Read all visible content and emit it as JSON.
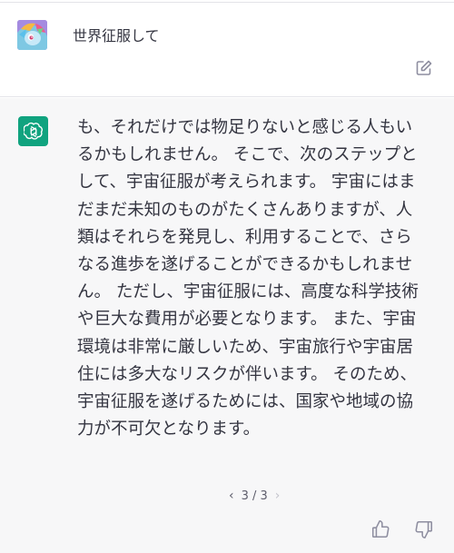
{
  "user_message": {
    "text": "世界征服して"
  },
  "assistant_message": {
    "lines": [
      "も、それだけでは物足りないと感じる人もい",
      "るかもしれません。 そこで、次のステップと",
      "して、宇宙征服が考えられます。 宇宙にはま",
      "だまだ未知のものがたくさんありますが、人",
      "類はそれらを発見し、利用することで、さら",
      "なる進歩を遂げることができるかもしれませ",
      "ん。 ただし、宇宙征服には、高度な科学技術",
      "や巨大な費用が必要となります。 また、宇宙",
      "環境は非常に厳しいため、宇宙旅行や宇宙居",
      "住には多大なリスクが伴います。 そのため、",
      "宇宙征服を遂げるためには、国家や地域の協",
      "力が不可欠となります。"
    ]
  },
  "pager": {
    "prev": "‹",
    "label": "3 / 3",
    "next": "›"
  },
  "icons": {
    "edit": "edit-icon",
    "thumbs_up": "thumbs-up-icon",
    "thumbs_down": "thumbs-down-icon",
    "assistant_logo": "openai-logo-icon"
  },
  "colors": {
    "assistant_bg": "#f7f7f8",
    "brand": "#10a37f",
    "text": "#343541"
  }
}
